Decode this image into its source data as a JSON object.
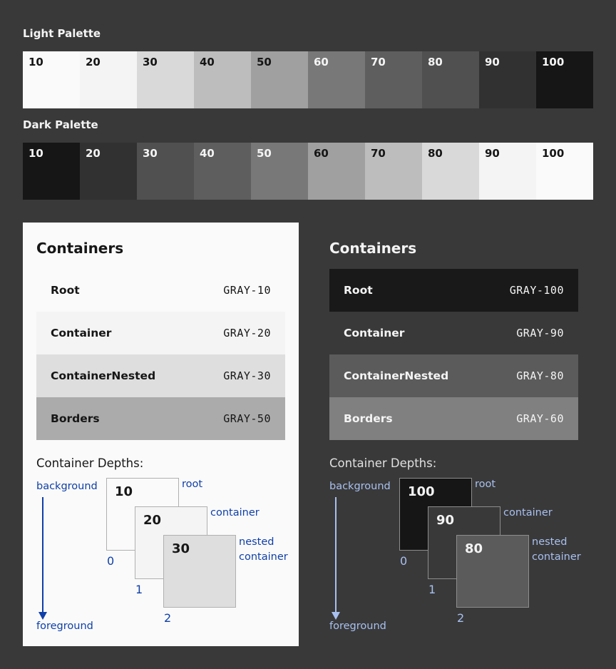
{
  "light_palette": {
    "title": "Light Palette",
    "swatches": [
      {
        "label": "10",
        "color": "#fafafa",
        "text_color": "#161616"
      },
      {
        "label": "20",
        "color": "#f4f4f4",
        "text_color": "#161616"
      },
      {
        "label": "30",
        "color": "#d9d9d9",
        "text_color": "#161616"
      },
      {
        "label": "40",
        "color": "#bdbdbd",
        "text_color": "#161616"
      },
      {
        "label": "50",
        "color": "#a0a0a0",
        "text_color": "#161616"
      },
      {
        "label": "60",
        "color": "#787878",
        "text_color": "#f4f4f4"
      },
      {
        "label": "70",
        "color": "#5e5e5e",
        "text_color": "#f4f4f4"
      },
      {
        "label": "80",
        "color": "#505050",
        "text_color": "#f4f4f4"
      },
      {
        "label": "90",
        "color": "#313131",
        "text_color": "#f4f4f4"
      },
      {
        "label": "100",
        "color": "#161616",
        "text_color": "#f4f4f4"
      }
    ]
  },
  "dark_palette": {
    "title": "Dark Palette",
    "swatches": [
      {
        "label": "10",
        "color": "#161616",
        "text_color": "#f4f4f4"
      },
      {
        "label": "20",
        "color": "#313131",
        "text_color": "#f4f4f4"
      },
      {
        "label": "30",
        "color": "#505050",
        "text_color": "#f4f4f4"
      },
      {
        "label": "40",
        "color": "#5e5e5e",
        "text_color": "#f4f4f4"
      },
      {
        "label": "50",
        "color": "#787878",
        "text_color": "#f4f4f4"
      },
      {
        "label": "60",
        "color": "#a0a0a0",
        "text_color": "#161616"
      },
      {
        "label": "70",
        "color": "#bdbdbd",
        "text_color": "#161616"
      },
      {
        "label": "80",
        "color": "#d9d9d9",
        "text_color": "#161616"
      },
      {
        "label": "90",
        "color": "#f4f4f4",
        "text_color": "#161616"
      },
      {
        "label": "100",
        "color": "#fafafa",
        "text_color": "#161616"
      }
    ]
  },
  "light_panel": {
    "title": "Containers",
    "rows": [
      {
        "name": "Root",
        "value": "GRAY-10",
        "color": "#fafafa",
        "text_color": "#161616"
      },
      {
        "name": "Container",
        "value": "GRAY-20",
        "color": "#f4f4f4",
        "text_color": "#161616"
      },
      {
        "name": "ContainerNested",
        "value": "GRAY-30",
        "color": "#dedede",
        "text_color": "#161616"
      },
      {
        "name": "Borders",
        "value": "GRAY-50",
        "color": "#ababab",
        "text_color": "#161616"
      }
    ],
    "depths": {
      "title": "Container Depths:",
      "background_label": "background",
      "foreground_label": "foreground",
      "boxes": [
        {
          "value": "10",
          "name": "root",
          "index": "0",
          "color": "#fafafa"
        },
        {
          "value": "20",
          "name": "container",
          "index": "1",
          "color": "#f4f4f4"
        },
        {
          "value": "30",
          "name_line1": "nested",
          "name_line2": "container",
          "index": "2",
          "color": "#dedede"
        }
      ]
    }
  },
  "dark_panel": {
    "title": "Containers",
    "rows": [
      {
        "name": "Root",
        "value": "GRAY-100",
        "color": "#191919",
        "text_color": "#f4f4f4"
      },
      {
        "name": "Container",
        "value": "GRAY-90",
        "color": "#393939",
        "text_color": "#f4f4f4"
      },
      {
        "name": "ContainerNested",
        "value": "GRAY-80",
        "color": "#5b5b5b",
        "text_color": "#f4f4f4"
      },
      {
        "name": "Borders",
        "value": "GRAY-60",
        "color": "#808080",
        "text_color": "#f4f4f4"
      }
    ],
    "depths": {
      "title": "Container Depths:",
      "background_label": "background",
      "foreground_label": "foreground",
      "boxes": [
        {
          "value": "100",
          "name": "root",
          "index": "0",
          "color": "#161616"
        },
        {
          "value": "90",
          "name": "container",
          "index": "1",
          "color": "#393939"
        },
        {
          "value": "80",
          "name_line1": "nested",
          "name_line2": "container",
          "index": "2",
          "color": "#5b5b5b"
        }
      ]
    }
  }
}
